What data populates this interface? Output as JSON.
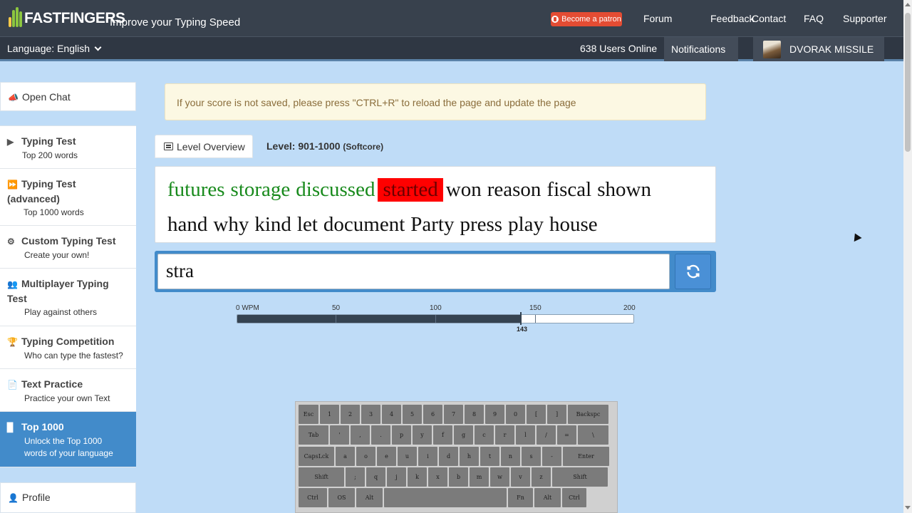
{
  "header": {
    "logo_text": "FASTFINGERS",
    "tagline": "Improve your Typing Speed",
    "patron_label": "Become a patron",
    "nav": [
      "Forum",
      "Feedback",
      "Contact",
      "FAQ",
      "Supporter"
    ]
  },
  "subbar": {
    "language": "Language: English",
    "users_online": "638 Users Online",
    "notifications": "Notifications",
    "username": "DVORAK MISSILE"
  },
  "sidebar": {
    "open_chat": "Open Chat",
    "items": [
      {
        "title": "Typing Test",
        "subtitle": "Top 200 words"
      },
      {
        "title": "Typing Test (advanced)",
        "subtitle": "Top 1000 words"
      },
      {
        "title": "Custom Typing Test",
        "subtitle": "Create your own!"
      },
      {
        "title": "Multiplayer Typing Test",
        "subtitle": "Play against others"
      },
      {
        "title": "Typing Competition",
        "subtitle": "Who can type the fastest?"
      },
      {
        "title": "Text Practice",
        "subtitle": "Practice your own Text"
      },
      {
        "title": "Top 1000",
        "subtitle": "Unlock the Top 1000 words of your language"
      }
    ],
    "profile": "Profile"
  },
  "alert": "If your score is not saved, please press \"CTRL+R\" to reload the page and update the page",
  "level": {
    "button": "Level Overview",
    "label": "Level: 901-1000",
    "mode": "(Softcore)"
  },
  "words": {
    "line1": [
      "futures",
      "storage",
      "discussed",
      "started",
      "won",
      "reason",
      "fiscal",
      "shown"
    ],
    "line1_status": [
      "correct",
      "correct",
      "correct",
      "current",
      "pending",
      "pending",
      "pending",
      "pending"
    ],
    "line2": [
      "hand",
      "why",
      "kind",
      "let",
      "document",
      "Party",
      "press",
      "play",
      "house"
    ]
  },
  "input": {
    "value": "stra"
  },
  "wpm": {
    "labels": [
      "0 WPM",
      "50",
      "100",
      "150",
      "200"
    ],
    "max": 200,
    "current": 143,
    "current_label": "143"
  },
  "keyboard": {
    "rows": [
      [
        "Esc",
        "1",
        "2",
        "3",
        "4",
        "5",
        "6",
        "7",
        "8",
        "9",
        "0",
        "[",
        "]",
        "Backspc"
      ],
      [
        "Tab",
        "'",
        ",",
        ".",
        "p",
        "y",
        "f",
        "g",
        "c",
        "r",
        "l",
        "/",
        "=",
        "\\"
      ],
      [
        "CapsLck",
        "a",
        "o",
        "e",
        "u",
        "i",
        "d",
        "h",
        "t",
        "n",
        "s",
        "-",
        "Enter"
      ],
      [
        "Shift",
        ";",
        "q",
        "j",
        "k",
        "x",
        "b",
        "m",
        "w",
        "v",
        "z",
        "Shift"
      ],
      [
        "Ctrl",
        "OS",
        "Alt",
        "",
        "Fn",
        "Alt",
        "Ctrl"
      ]
    ]
  },
  "colors": {
    "correct": "#188a1c",
    "current_bg": "#ff0000",
    "accent": "#428bca"
  }
}
